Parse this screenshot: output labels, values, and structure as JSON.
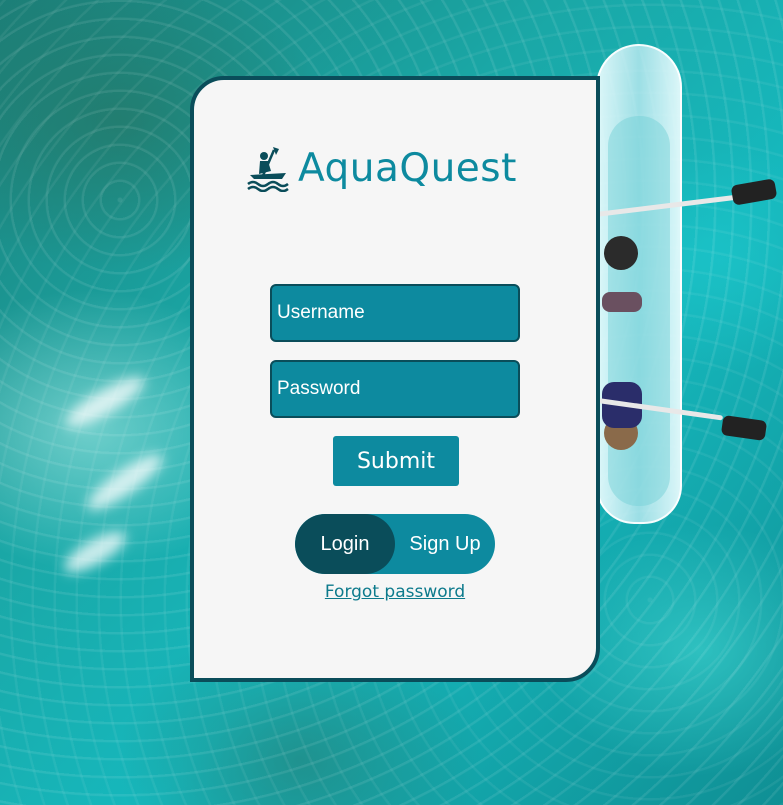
{
  "app": {
    "name": "AquaQuest",
    "logo_icon": "kayaker-icon"
  },
  "form": {
    "username_placeholder": "Username",
    "password_placeholder": "Password",
    "submit_label": "Submit"
  },
  "toggle": {
    "login_label": "Login",
    "signup_label": "Sign Up",
    "active": "Login"
  },
  "links": {
    "forgot_password": "Forgot password"
  },
  "colors": {
    "brand": "#0d8a9f",
    "dark": "#0a4d5a",
    "card_bg": "#f6f6f6"
  }
}
